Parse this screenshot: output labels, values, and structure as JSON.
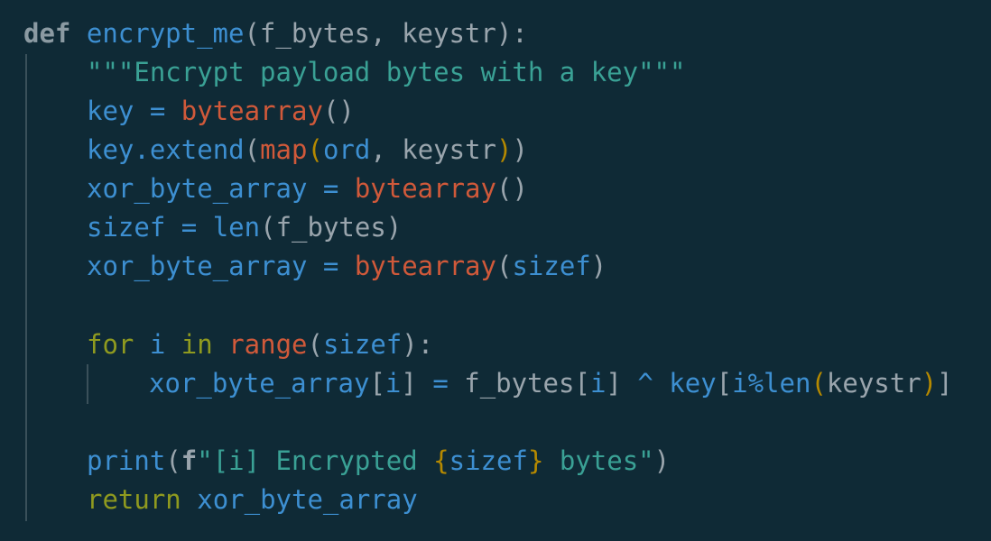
{
  "code": {
    "line1": {
      "kw_def": "def",
      "fn_name": "encrypt_me",
      "params": "(f_bytes, keystr):"
    },
    "line2": {
      "docstring": "\"\"\"Encrypt payload bytes with a key\"\"\""
    },
    "line3": {
      "var": "key",
      "op": "=",
      "builtin": "bytearray",
      "args": "()"
    },
    "line4": {
      "obj": "key",
      "method": ".extend",
      "paren_open": "(",
      "builtin": "map",
      "inner_open": "(",
      "ord": "ord",
      "sep": ", keystr",
      "inner_close": ")",
      "paren_close": ")"
    },
    "line5": {
      "var": "xor_byte_array",
      "op": "=",
      "builtin": "bytearray",
      "args": "()"
    },
    "line6": {
      "var": "sizef",
      "op": "=",
      "builtin": "len",
      "args": "(f_bytes)"
    },
    "line7": {
      "var": "xor_byte_array",
      "op": "=",
      "builtin": "bytearray",
      "open": "(",
      "arg": "sizef",
      "close": ")"
    },
    "line9": {
      "kw_for": "for",
      "iter": "i",
      "kw_in": "in",
      "builtin": "range",
      "open": "(",
      "arg": "sizef",
      "close": "):"
    },
    "line10": {
      "target": "xor_byte_array",
      "b1_open": "[",
      "i1": "i",
      "b1_close": "]",
      "op": "=",
      "src": "f_bytes",
      "b2_open": "[",
      "i2": "i",
      "b2_close": "]",
      "xor": "^",
      "key": "key",
      "b3_open": "[",
      "i3": "i%len",
      "p_open": "(",
      "keystr": "keystr",
      "p_close": ")",
      "b3_close": "]"
    },
    "line12": {
      "fn": "print",
      "open": "(",
      "fprefix": "f",
      "str_start": "\"[i] Encrypted ",
      "interp_open": "{",
      "interp_var": "sizef",
      "interp_close": "}",
      "str_end": " bytes\"",
      "close": ")"
    },
    "line13": {
      "kw_return": "return",
      "value": "xor_byte_array"
    }
  },
  "colors": {
    "background": "#0f2a36",
    "keyword_def": "#8b9aa2",
    "identifier_blue": "#3d8fd1",
    "builtin_orange": "#d0593a",
    "string_teal": "#3aa195",
    "control_olive": "#8f9a1f",
    "interpolation_yellow": "#b58900",
    "plain": "#9aa5ad"
  }
}
